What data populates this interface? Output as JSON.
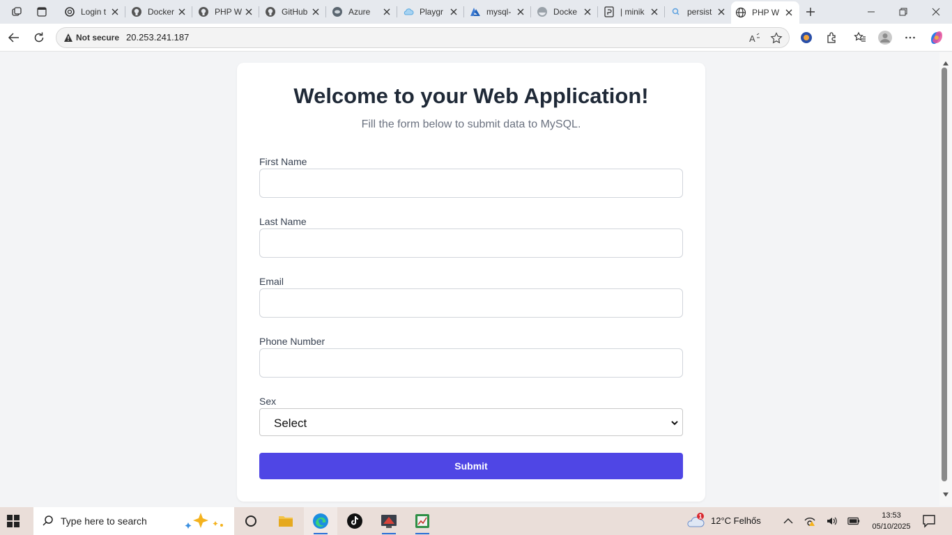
{
  "browser": {
    "tabs": [
      {
        "title": "Login t",
        "icon": "openai-icon"
      },
      {
        "title": "Docker",
        "icon": "github-icon"
      },
      {
        "title": "PHP W",
        "icon": "github-icon"
      },
      {
        "title": "GitHub",
        "icon": "github-icon"
      },
      {
        "title": "Azure",
        "icon": "azure-icon"
      },
      {
        "title": "Playgr",
        "icon": "cloud-icon"
      },
      {
        "title": "mysql-",
        "icon": "azure-a-icon"
      },
      {
        "title": "Docke",
        "icon": "docker-icon"
      },
      {
        "title": "| minik",
        "icon": "page-icon"
      },
      {
        "title": "persist",
        "icon": "search-icon"
      },
      {
        "title": "PHP W",
        "icon": "globe-icon"
      }
    ],
    "address": {
      "security_label": "Not secure",
      "url": "20.253.241.187"
    }
  },
  "page": {
    "title": "Welcome to your Web Application!",
    "subtitle": "Fill the form below to submit data to MySQL.",
    "fields": {
      "first_name": {
        "label": "First Name",
        "value": ""
      },
      "last_name": {
        "label": "Last Name",
        "value": ""
      },
      "email": {
        "label": "Email",
        "value": ""
      },
      "phone": {
        "label": "Phone Number",
        "value": ""
      },
      "sex": {
        "label": "Sex",
        "selected": "Select"
      }
    },
    "submit_label": "Submit"
  },
  "taskbar": {
    "search_placeholder": "Type here to search",
    "weather": {
      "temp": "12°C",
      "condition": "Felhős",
      "badge": "1"
    },
    "clock": {
      "time": "13:53",
      "date": "05/10/2025"
    }
  },
  "colors": {
    "accent": "#4f46e5",
    "page_bg": "#f3f4f6",
    "heading": "#1f2937",
    "muted": "#6b7280"
  }
}
